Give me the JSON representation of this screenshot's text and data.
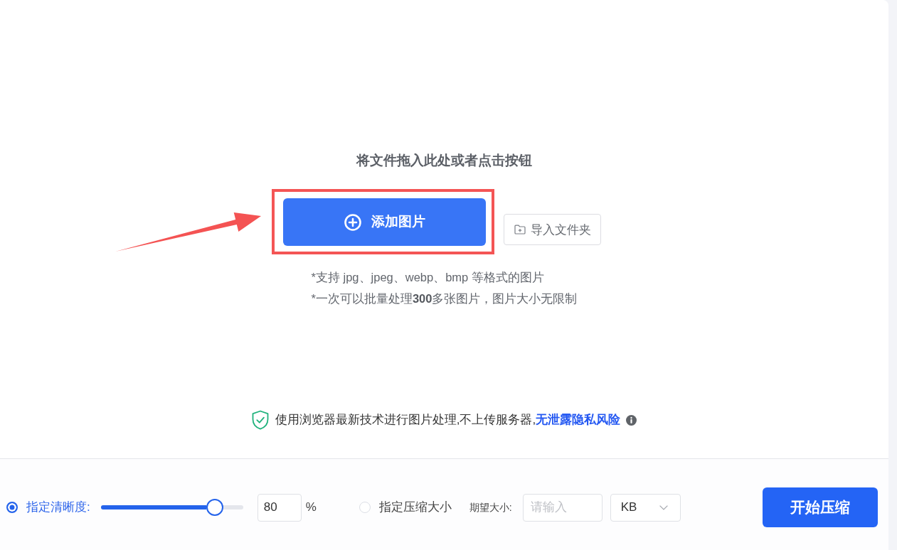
{
  "upload": {
    "heading": "将文件拖入此处或者点击按钮",
    "add_button": {
      "label": "添加图片",
      "highlighted": true
    },
    "import_button": {
      "label": "导入文件夹"
    },
    "notes": [
      "*支持 jpg、jpeg、webp、bmp 等格式的图片",
      "*一次可以批量处理**300**多张图片，图片大小无限制"
    ],
    "privacy": {
      "text": "使用浏览器最新技术进行图片处理,不上传服务器,",
      "link": "无泄露隐私风险"
    }
  },
  "settings": {
    "modes": [
      {
        "kind": "quality",
        "label": "指定清晰度:",
        "selected": true,
        "level": 0.8,
        "value": "80",
        "unit": "%"
      },
      {
        "kind": "size",
        "label": "指定压缩大小",
        "selected": false,
        "target_label": "期望大小:",
        "placeholder": "请输入",
        "unit": "KB"
      }
    ],
    "start_button": "开始压缩"
  }
}
